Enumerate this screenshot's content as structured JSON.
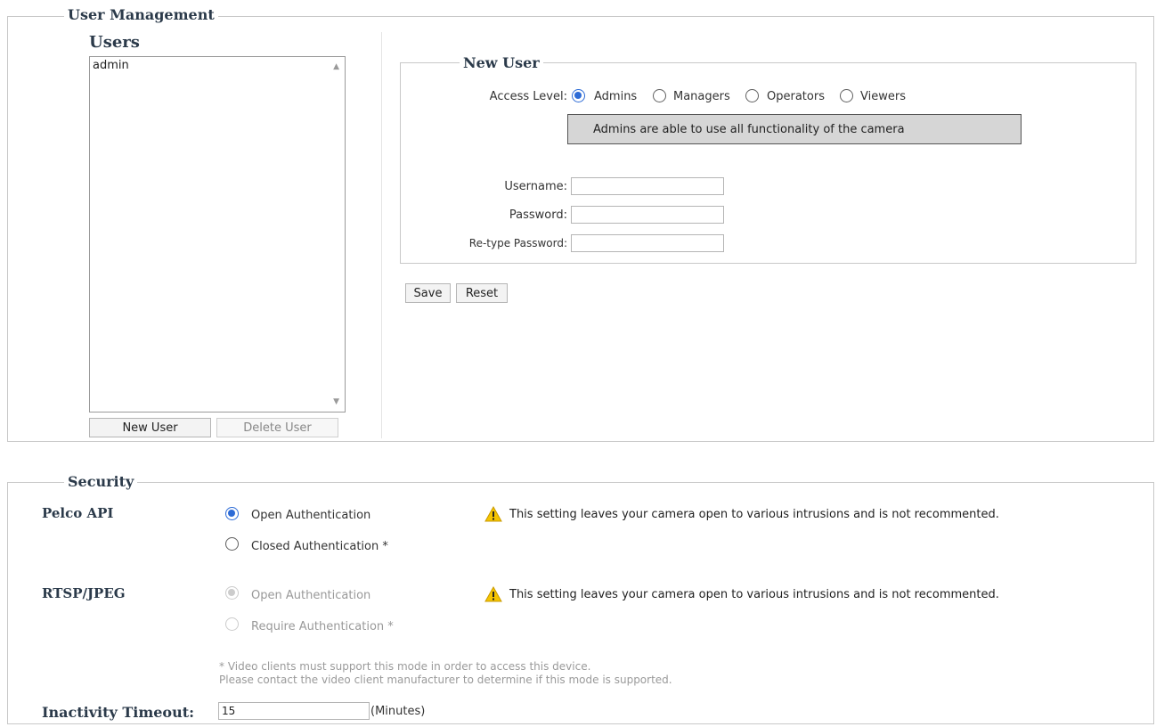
{
  "user_management": {
    "legend": "User Management",
    "users_title": "Users",
    "users": [
      "admin"
    ],
    "new_user_button": "New User",
    "delete_user_button": "Delete User"
  },
  "new_user": {
    "legend": "New User",
    "access_level_label": "Access Level:",
    "access_levels": [
      {
        "label": "Admins",
        "selected": true
      },
      {
        "label": "Managers",
        "selected": false
      },
      {
        "label": "Operators",
        "selected": false
      },
      {
        "label": "Viewers",
        "selected": false
      }
    ],
    "description": "Admins are able to use all functionality of the camera",
    "username_label": "Username:",
    "username_value": "",
    "password_label": "Password:",
    "password_value": "",
    "retype_label": "Re-type Password:",
    "retype_value": "",
    "save_button": "Save",
    "reset_button": "Reset"
  },
  "security": {
    "legend": "Security",
    "pelco_api": {
      "label": "Pelco API",
      "options": [
        {
          "label": "Open Authentication",
          "selected": true,
          "disabled": false
        },
        {
          "label": "Closed Authentication *",
          "selected": false,
          "disabled": false
        }
      ],
      "warning": "This setting leaves your camera open to various intrusions and is not recommented."
    },
    "rtsp_jpeg": {
      "label": "RTSP/JPEG",
      "options": [
        {
          "label": "Open Authentication",
          "selected": true,
          "disabled": true
        },
        {
          "label": "Require Authentication *",
          "selected": false,
          "disabled": true
        }
      ],
      "warning": "This setting leaves your camera open to various intrusions and is not recommented."
    },
    "note_line1": "* Video clients must support this mode in order to access this device.",
    "note_line2": "Please contact the video client manufacturer to determine if this mode is supported.",
    "inactivity_label": "Inactivity Timeout:",
    "inactivity_value": "15",
    "inactivity_unit": "(Minutes)"
  },
  "colors": {
    "accent": "#2d6bd6",
    "warning": "#f5c400",
    "heading": "#2b3a4a"
  }
}
